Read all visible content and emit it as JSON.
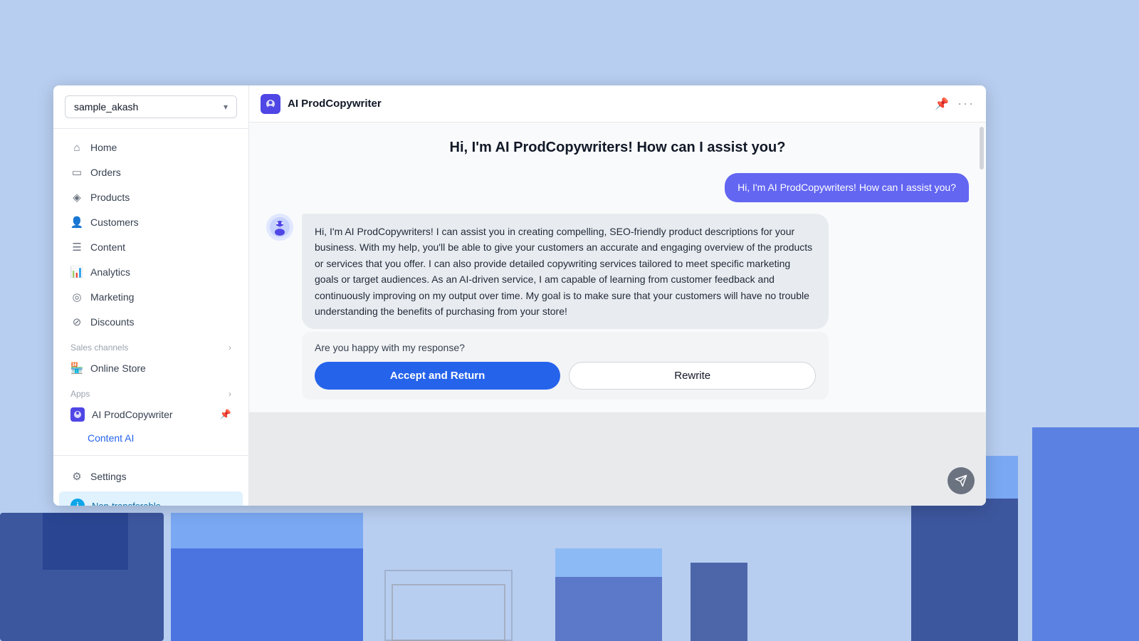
{
  "background": {
    "color": "#b8cef0"
  },
  "sidebar": {
    "store_name": "sample_akash",
    "nav_items": [
      {
        "id": "home",
        "label": "Home",
        "icon": "home"
      },
      {
        "id": "orders",
        "label": "Orders",
        "icon": "orders"
      },
      {
        "id": "products",
        "label": "Products",
        "icon": "products"
      },
      {
        "id": "customers",
        "label": "Customers",
        "icon": "customers"
      },
      {
        "id": "content",
        "label": "Content",
        "icon": "content"
      },
      {
        "id": "analytics",
        "label": "Analytics",
        "icon": "analytics"
      },
      {
        "id": "marketing",
        "label": "Marketing",
        "icon": "marketing"
      },
      {
        "id": "discounts",
        "label": "Discounts",
        "icon": "discounts"
      }
    ],
    "sales_channels_label": "Sales channels",
    "sales_channels": [
      {
        "id": "online-store",
        "label": "Online Store"
      }
    ],
    "apps_label": "Apps",
    "apps": [
      {
        "id": "ai-prodcopywriter",
        "label": "AI ProdCopywriter"
      }
    ],
    "sub_apps": [
      {
        "id": "content-ai",
        "label": "Content AI"
      }
    ],
    "settings_label": "Settings",
    "non_transferable_label": "Non-transferable"
  },
  "topbar": {
    "app_name": "AI ProdCopywriter"
  },
  "chat": {
    "greeting": "Hi, I'm AI ProdCopywriters! How can I assist you?",
    "user_message": "Hi, I'm AI ProdCopywriters! How can I assist you?",
    "bot_response": "Hi, I'm AI ProdCopywriters! I can assist you in creating compelling, SEO-friendly product descriptions for your business. With my help, you'll be able to give your customers an accurate and engaging overview of the products or services that you offer. I can also provide detailed copywriting services tailored to meet specific marketing goals or target audiences. As an AI-driven service, I am capable of learning from customer feedback and continuously improving on my output over time. My goal is to make sure that your customers will have no trouble understanding the benefits of purchasing from your store!",
    "response_question": "Are you happy with my response?",
    "accept_button": "Accept and Return",
    "rewrite_button": "Rewrite",
    "input_placeholder": ""
  }
}
